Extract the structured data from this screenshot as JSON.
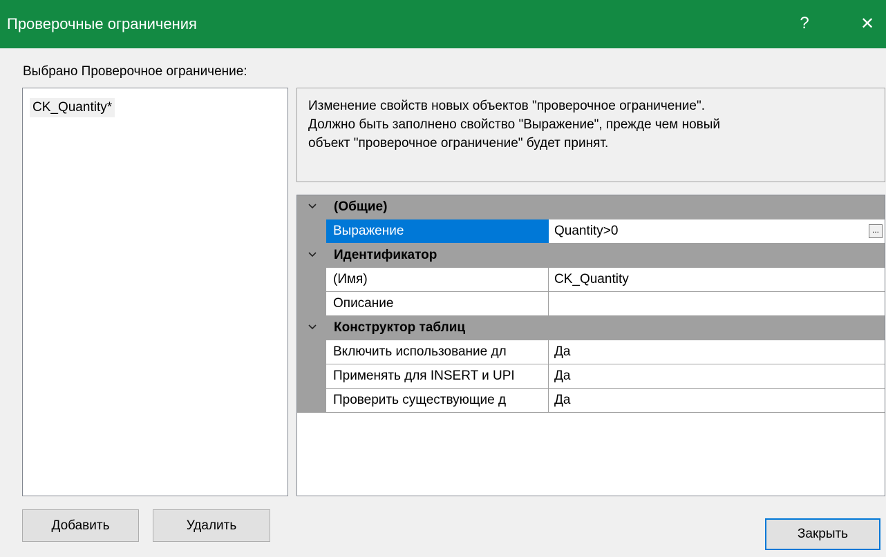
{
  "window": {
    "title": "Проверочные ограничения",
    "help_glyph": "?",
    "close_glyph": "✕"
  },
  "selected_label": "Выбрано Проверочное ограничение:",
  "constraints": [
    "CK_Quantity*"
  ],
  "description": {
    "line1": "Изменение свойств новых объектов \"проверочное ограничение\".",
    "line2": "Должно быть заполнено свойство \"Выражение\", прежде чем новый",
    "line3": "объект \"проверочное ограничение\" будет принят."
  },
  "grid": {
    "cat_general": "(Общие)",
    "expression_name": "Выражение",
    "expression_value": "Quantity>0",
    "ellipsis": "...",
    "cat_identity": "Идентификатор",
    "name_name": "(Имя)",
    "name_value": "CK_Quantity",
    "desc_name": "Описание",
    "desc_value": "",
    "cat_designer": "Конструктор таблиц",
    "enforce_repl_name": "Включить использование дл",
    "enforce_repl_value": "Да",
    "enforce_insert_name": "Применять для INSERT и UPI",
    "enforce_insert_value": "Да",
    "check_existing_name": "Проверить существующие д",
    "check_existing_value": "Да"
  },
  "buttons": {
    "add": "Добавить",
    "delete": "Удалить",
    "close": "Закрыть"
  },
  "colors": {
    "titlebar": "#138a43",
    "selection": "#0078d7",
    "category_band": "#a0a0a0"
  },
  "icons": {
    "help": "question-mark-icon",
    "close": "close-icon",
    "collapse": "chevron-down-icon"
  }
}
